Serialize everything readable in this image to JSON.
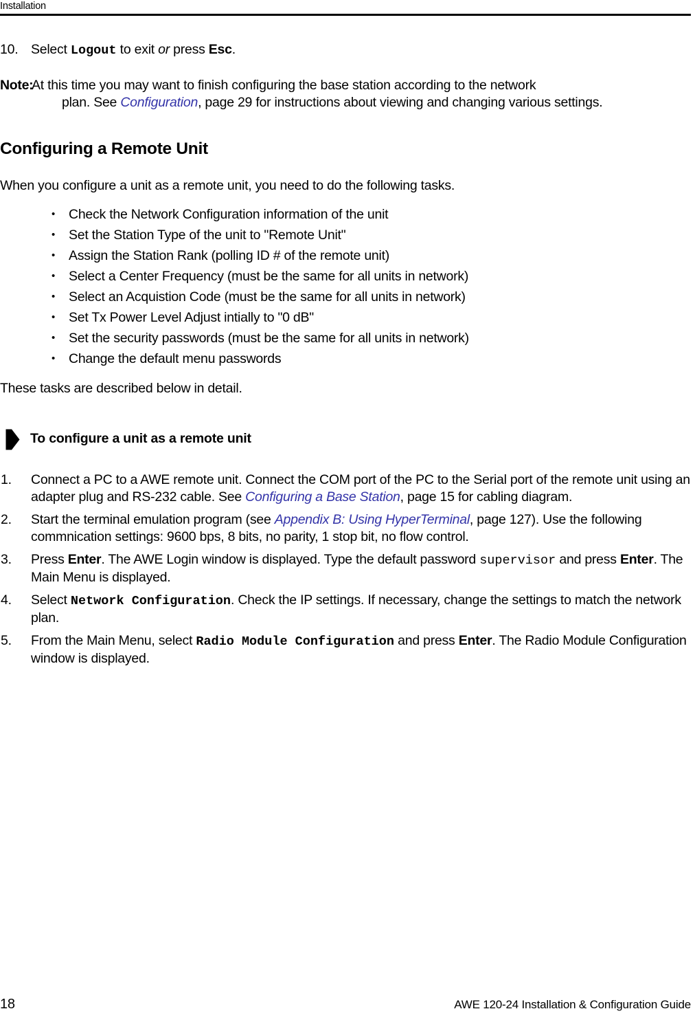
{
  "header": {
    "chapter_title": "Installation"
  },
  "continued_step": {
    "number": "10.",
    "text_before_cmd": "Select ",
    "command": "Logout",
    "text_mid": " to exit ",
    "emphasis": "or",
    "text_after": " press ",
    "key": "Esc",
    "text_end": "."
  },
  "note": {
    "label": "Note:",
    "line1": "At this time you may want to finish configuring the base station according to the network",
    "line2_pre": "plan. See ",
    "line2_xref": "Configuration",
    "line2_post": ", page 29 for instructions about viewing and changing various settings."
  },
  "section": {
    "heading": "Configuring a Remote Unit",
    "lead": "When you configure a unit as a remote unit, you need to do the following tasks.",
    "bullet_glyph": "•",
    "tasks": [
      "Check the Network Configuration information of the unit",
      "Set the Station Type of the unit to \"Remote Unit\"",
      "Assign the Station Rank (polling ID # of the remote unit)",
      "Select a Center Frequency (must be the same for all units in network)",
      "Select an Acquistion Code (must be the same for all units in network)",
      "Set Tx Power Level Adjust intially to \"0 dB\"",
      "Set the security passwords (must be the same for all units in network)",
      "Change the default menu passwords"
    ],
    "closing": "These tasks are described below in detail."
  },
  "procedure": {
    "arrow_icon": "pennant-arrow-icon",
    "title": "To configure a unit as a remote unit",
    "steps": [
      {
        "number": "1.",
        "parts": [
          {
            "type": "text",
            "value": "Connect a PC to a AWE remote unit. Connect the COM port of the PC to the Serial port of the remote unit using an adapter plug and RS-232 cable. See "
          },
          {
            "type": "xref",
            "value": "Configuring a Base Station"
          },
          {
            "type": "text",
            "value": ", page 15 for cabling diagram."
          }
        ]
      },
      {
        "number": "2.",
        "parts": [
          {
            "type": "text",
            "value": "Start the terminal emulation program (see "
          },
          {
            "type": "xref",
            "value": "Appendix B: Using HyperTerminal"
          },
          {
            "type": "text",
            "value": ", page 127). Use the following commnication settings: 9600 bps, 8 bits, no parity, 1 stop bit, no flow control."
          }
        ]
      },
      {
        "number": "3.",
        "parts": [
          {
            "type": "text",
            "value": "Press "
          },
          {
            "type": "bold",
            "value": "Enter"
          },
          {
            "type": "text",
            "value": ". The AWE Login window is displayed. Type the default password "
          },
          {
            "type": "mono",
            "value": "supervisor"
          },
          {
            "type": "text",
            "value": " and press "
          },
          {
            "type": "bold",
            "value": "Enter"
          },
          {
            "type": "text",
            "value": ". The Main Menu is displayed."
          }
        ]
      },
      {
        "number": "4.",
        "parts": [
          {
            "type": "text",
            "value": "Select "
          },
          {
            "type": "mono-bold",
            "value": "Network Configuration"
          },
          {
            "type": "text",
            "value": ". Check the IP settings. If necessary, change the settings to match the network plan."
          }
        ]
      },
      {
        "number": "5.",
        "parts": [
          {
            "type": "text",
            "value": "From the Main Menu, select "
          },
          {
            "type": "mono-bold",
            "value": "Radio Module Configuration"
          },
          {
            "type": "text",
            "value": " and press "
          },
          {
            "type": "bold",
            "value": "Enter"
          },
          {
            "type": "text",
            "value": ". The Radio Module Configuration window is displayed."
          }
        ]
      }
    ]
  },
  "footer": {
    "page_number": "18",
    "guide_title": "AWE 120-24 Installation & Configuration Guide"
  },
  "colors": {
    "xref_link": "#3333A8",
    "rule": "#000000",
    "text": "#000000"
  }
}
